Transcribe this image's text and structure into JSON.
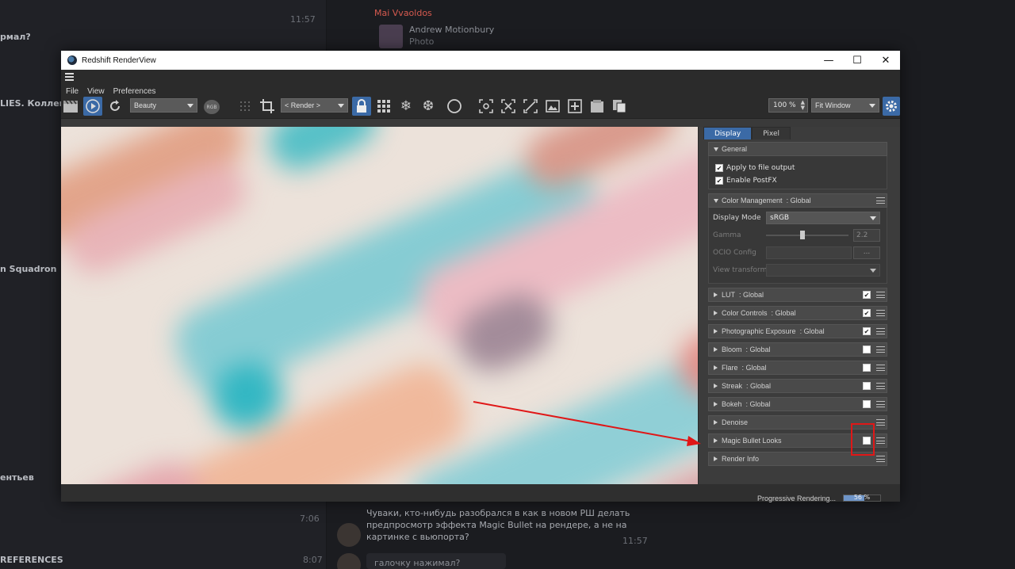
{
  "background_app": {
    "sidebar_snippets": [
      {
        "text": "11:57"
      },
      {
        "text": "рмал?"
      },
      {
        "text": "LIES. Коллекти"
      },
      {
        "text": "n Squadron"
      },
      {
        "text": "ентьев"
      },
      {
        "text": "REFERENCES"
      }
    ],
    "header_name": "Mai Vvaoldos",
    "header_sub": "Andrew Motionbury",
    "header_sub2": "Photo",
    "message": "Чуваки, кто-нибудь разобрался в как в новом РШ делать предпросмотр эффекта Magic Bullet на рендере, а не на картинке с вьюпорта?",
    "message_time": "11:57",
    "reply": "галочку нажимал?",
    "time_left_1": "7:06",
    "time_left_2": "8:07"
  },
  "window": {
    "title": "Redshift RenderView",
    "controls": {
      "minimize": "—",
      "maximize": "☐",
      "close": "✕"
    }
  },
  "menu": {
    "items": [
      "File",
      "View",
      "Preferences"
    ]
  },
  "toolbar": {
    "aov_dropdown": "Beauty",
    "rgb_badge": "RGB",
    "render_dropdown": "< Render >",
    "zoom_value": "100 %",
    "fit_dropdown": "Fit Window"
  },
  "panel": {
    "tabs": [
      "Display",
      "Pixel"
    ],
    "active_tab": "Display",
    "general": {
      "title": "General",
      "apply_to_file_output": "Apply to file output",
      "enable_postfx": "Enable PostFX"
    },
    "color_management": {
      "title": "Color Management",
      "scope": ": Global",
      "display_mode_label": "Display Mode",
      "display_mode_value": "sRGB",
      "gamma_label": "Gamma",
      "gamma_value": "2.2",
      "ocio_label": "OCIO Config",
      "ocio_button": "...",
      "view_transform_label": "View transform"
    },
    "sections": [
      {
        "title": "LUT",
        "scope": ": Global",
        "checked": true
      },
      {
        "title": "Color Controls",
        "scope": ": Global",
        "checked": true
      },
      {
        "title": "Photographic Exposure",
        "scope": ": Global",
        "checked": true
      },
      {
        "title": "Bloom",
        "scope": ": Global",
        "checked": false
      },
      {
        "title": "Flare",
        "scope": ": Global",
        "checked": false
      },
      {
        "title": "Streak",
        "scope": ": Global",
        "checked": false
      },
      {
        "title": "Bokeh",
        "scope": ": Global",
        "checked": false
      },
      {
        "title": "Denoise",
        "scope": "",
        "checked": null
      },
      {
        "title": "Magic Bullet Looks",
        "scope": "",
        "checked": false
      },
      {
        "title": "Render Info",
        "scope": "",
        "checked": null
      }
    ]
  },
  "status": {
    "progress_label": "Progressive Rendering...",
    "progress_percent": 56,
    "progress_text": "56 %"
  },
  "colors": {
    "accent": "#3b6aa6",
    "highlight": "#e01717"
  }
}
